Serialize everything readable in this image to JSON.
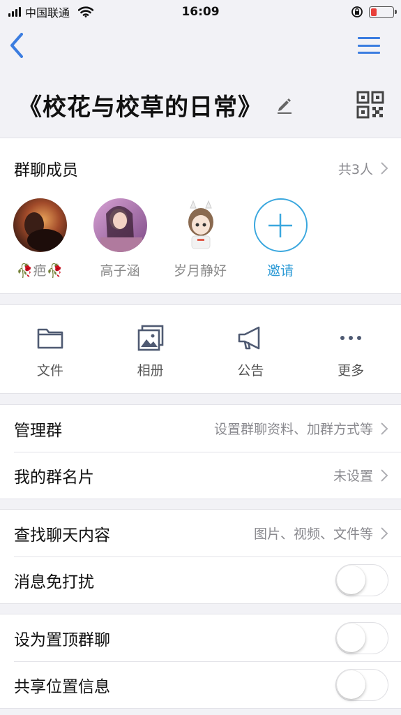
{
  "status_bar": {
    "carrier": "中国联通",
    "time": "16:09",
    "battery_level": 0.25,
    "battery_color": "#e8403a"
  },
  "nav": {
    "back_icon": "chevron-left-icon",
    "menu_icon": "hamburger-menu-icon",
    "accent_color": "#3b7de0"
  },
  "group": {
    "title": "《校花与校草的日常》",
    "edit_icon": "pencil-icon",
    "qr_icon": "qr-code-icon"
  },
  "members": {
    "title": "群聊成员",
    "count": "共3人",
    "list": [
      {
        "name": "🥀疤🥀",
        "avatar": "avatar-1"
      },
      {
        "name": "高子涵",
        "avatar": "avatar-2"
      },
      {
        "name": "岁月静好",
        "avatar": "avatar-3"
      }
    ],
    "invite_label": "邀请",
    "invite_color": "#2e9bd6"
  },
  "actions": [
    {
      "label": "文件",
      "icon": "folder-icon"
    },
    {
      "label": "相册",
      "icon": "photo-album-icon"
    },
    {
      "label": "公告",
      "icon": "megaphone-icon"
    },
    {
      "label": "更多",
      "icon": "more-dots-icon"
    }
  ],
  "settings": {
    "manage_group": {
      "label": "管理群",
      "value": "设置群聊资料、加群方式等"
    },
    "my_card": {
      "label": "我的群名片",
      "value": "未设置"
    },
    "search_chat": {
      "label": "查找聊天内容",
      "value": "图片、视频、文件等"
    },
    "mute": {
      "label": "消息免打扰",
      "enabled": false
    },
    "pin_top": {
      "label": "设为置顶群聊",
      "enabled": false
    },
    "share_location": {
      "label": "共享位置信息",
      "enabled": false
    }
  }
}
